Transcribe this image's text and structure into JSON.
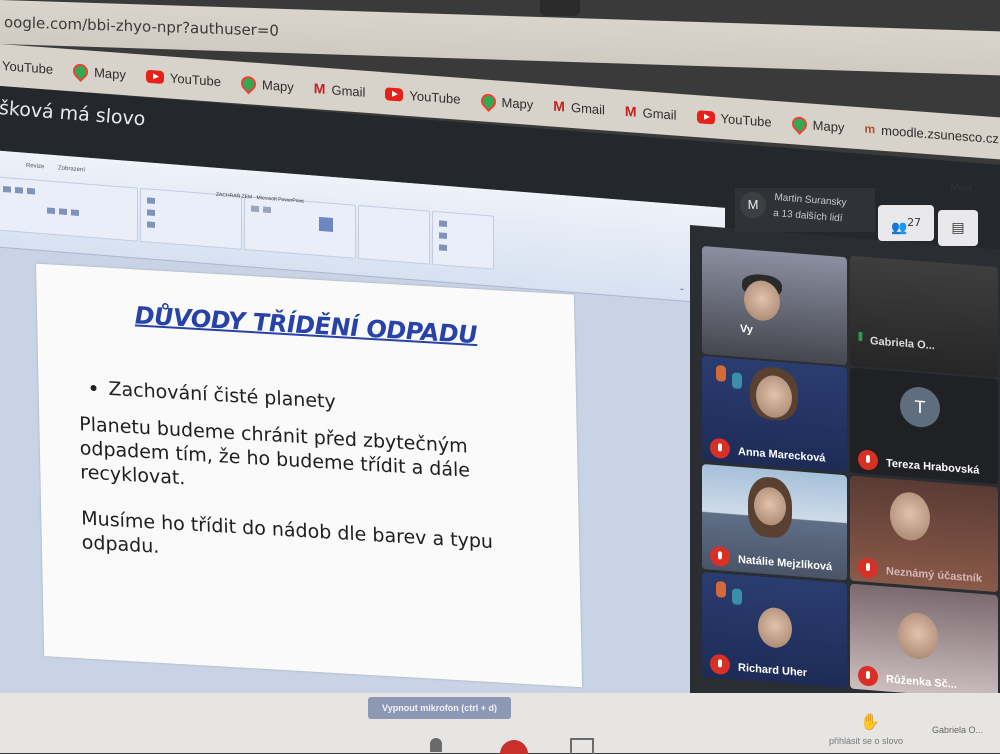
{
  "browser": {
    "url": "oogle.com/bbi-zhyo-npr?authuser=0",
    "bookmarks": [
      {
        "label": "YouTube",
        "icon": "youtube-icon"
      },
      {
        "label": "Mapy",
        "icon": "maps-pin-icon"
      },
      {
        "label": "YouTube",
        "icon": "youtube-icon"
      },
      {
        "label": "Mapy",
        "icon": "maps-pin-icon"
      },
      {
        "label": "Gmail",
        "icon": "gmail-icon"
      },
      {
        "label": "YouTube",
        "icon": "youtube-icon"
      },
      {
        "label": "Mapy",
        "icon": "maps-pin-icon"
      },
      {
        "label": "Gmail",
        "icon": "gmail-icon"
      },
      {
        "label": "Gmail",
        "icon": "gmail-icon"
      },
      {
        "label": "YouTube",
        "icon": "youtube-icon"
      },
      {
        "label": "Mapy",
        "icon": "maps-pin-icon"
      },
      {
        "label": "moodle.zsunesco.cz",
        "icon": "moodle-icon"
      }
    ]
  },
  "meet": {
    "title": "šková má slovo",
    "host_initial": "M",
    "host_line1": "Martin Suransky",
    "host_line2": "a 13 dalších lidí",
    "people_count": "27",
    "meet_label": "Meet",
    "tooltip": "Vypnout mikrofon (ctrl + d)",
    "raise_hand": "přihlásit se o slovo",
    "presenter": "Gabriela O..."
  },
  "participants": [
    {
      "name": "Vy",
      "muted": false
    },
    {
      "name": "Gabriela O...",
      "muted": false
    },
    {
      "name": "Anna Marecková",
      "muted": true
    },
    {
      "name": "Tereza Hrabovská",
      "muted": true,
      "initial": "T"
    },
    {
      "name": "Natálie Mejzlíková",
      "muted": true
    },
    {
      "name": "Neznámý účastník",
      "muted": true
    },
    {
      "name": "Richard Uher",
      "muted": true
    },
    {
      "name": "Růženka Sč...",
      "muted": true
    }
  ],
  "ppt": {
    "doc_title": "ZACHRAŇ ZEM - Microsoft PowerPoint",
    "tabs": [
      "Revize",
      "Zobrazení"
    ],
    "slide": {
      "title": "DŮVODY TŘÍDĚNÍ ODPADU",
      "bullet": "Zachování čisté planety",
      "para1": "Planetu budeme chránit před zbytečným odpadem tím, že ho budeme třídit a dále recyklovat.",
      "para2": "Musíme ho třídit do nádob dle barev a typu odpadu."
    }
  }
}
